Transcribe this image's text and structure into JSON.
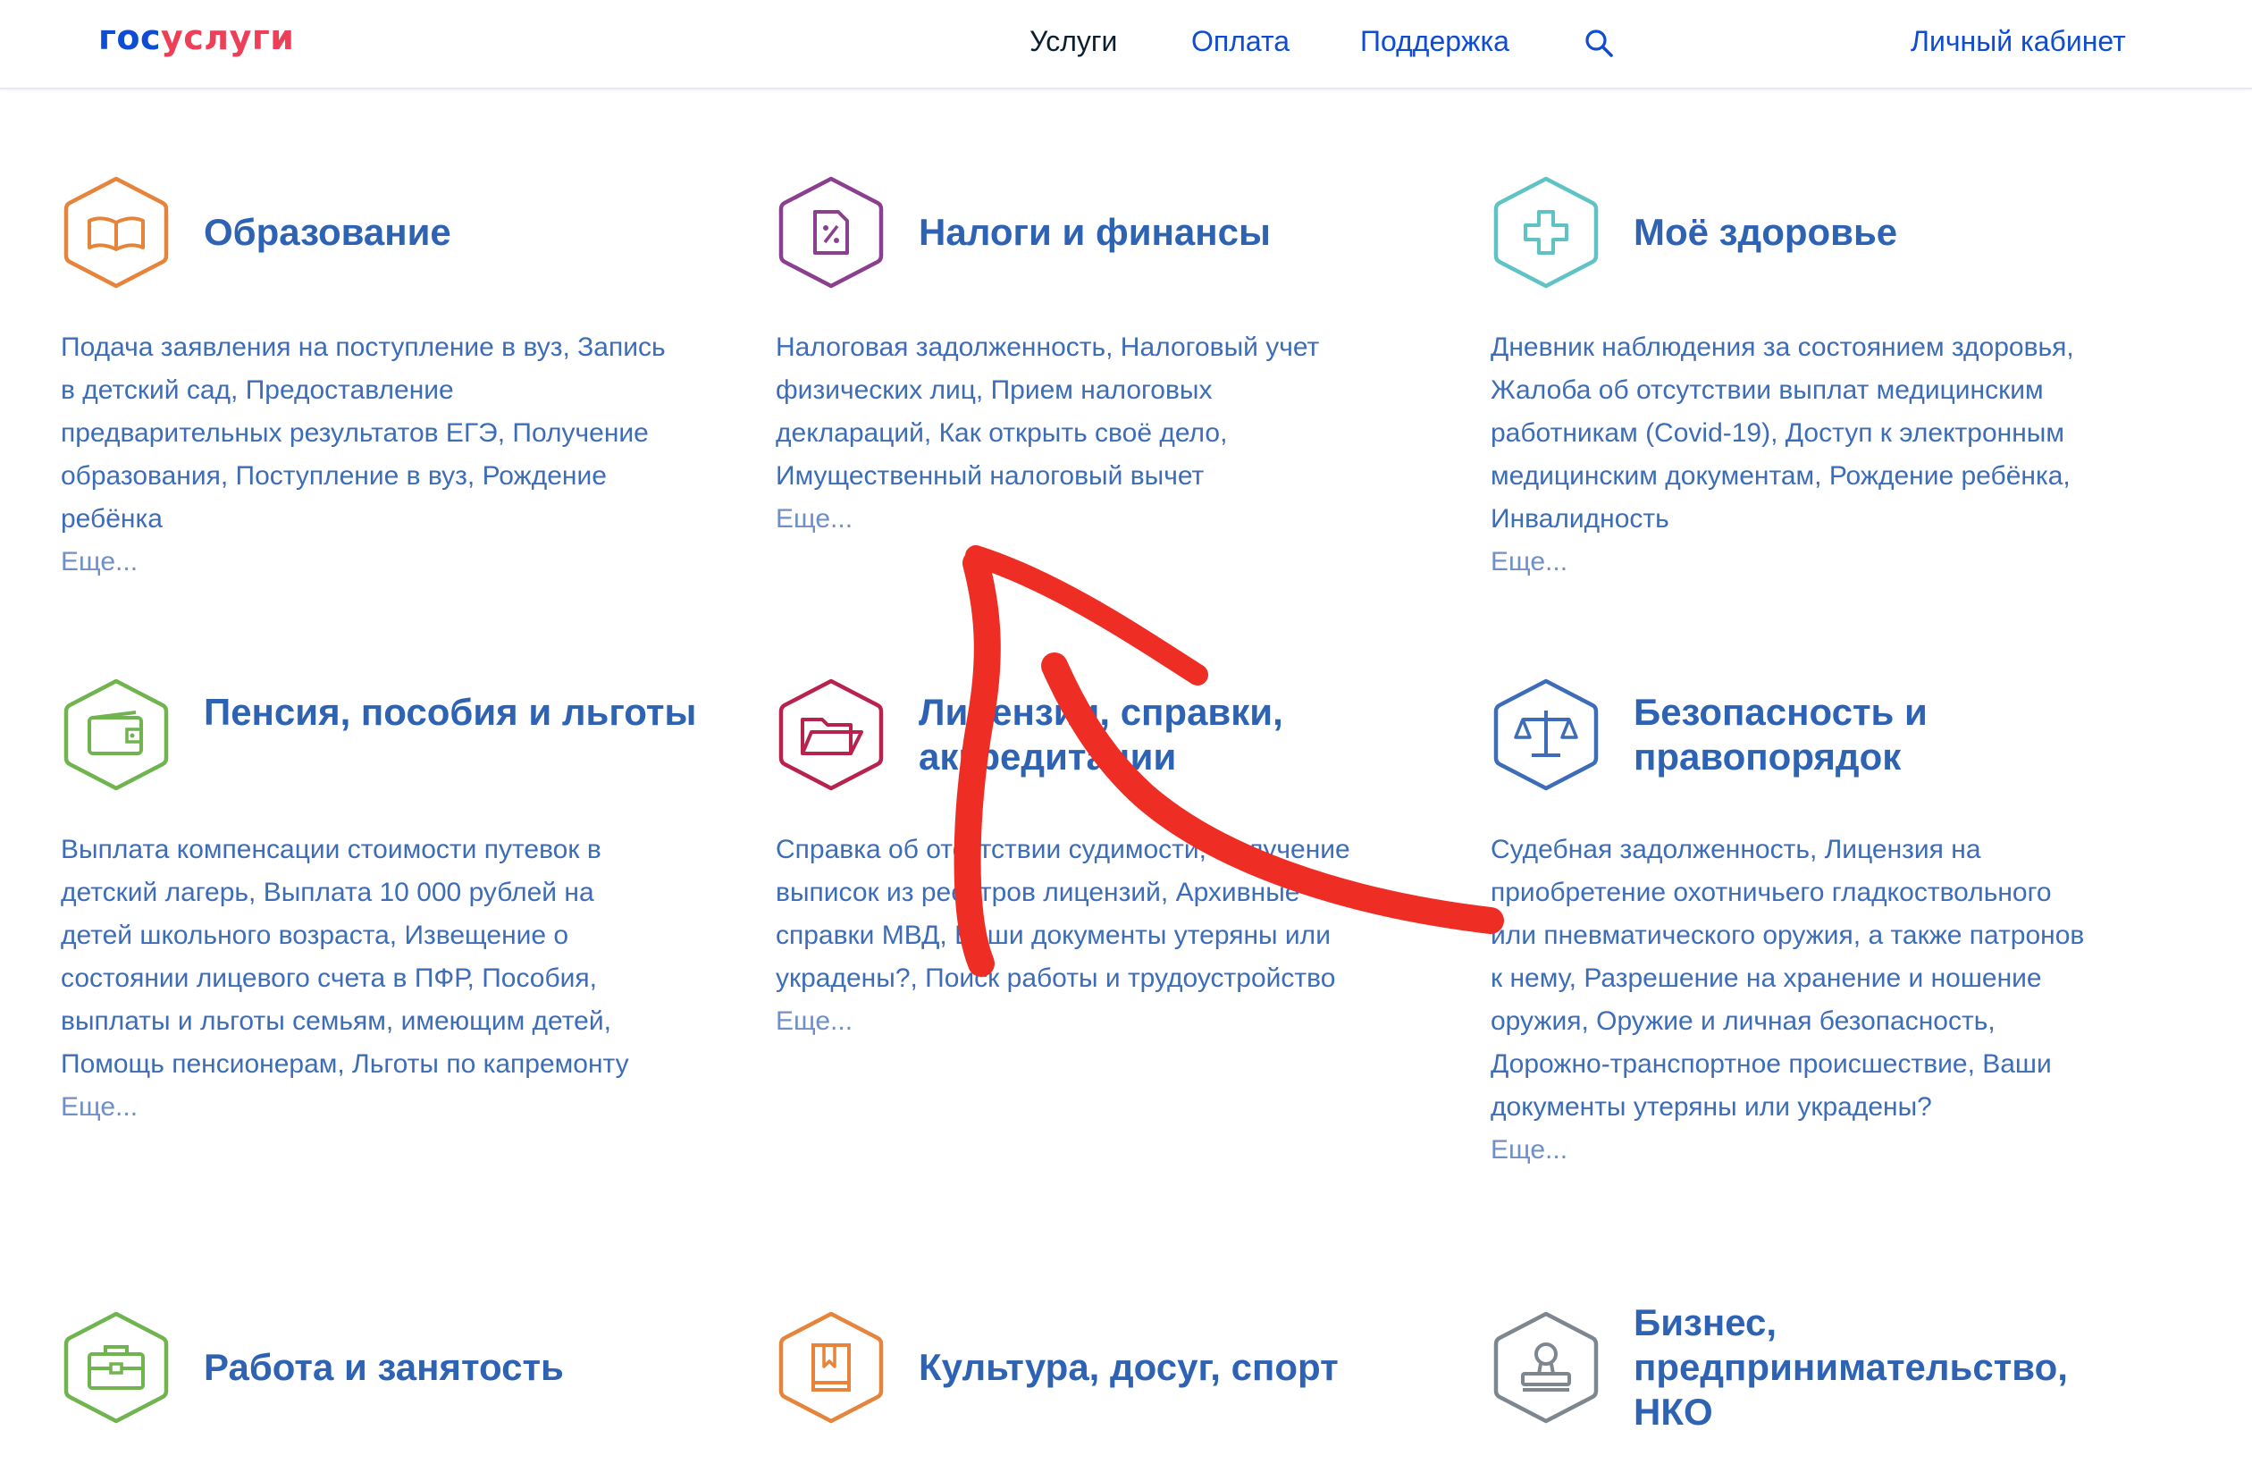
{
  "header": {
    "logo": {
      "part1": "гос",
      "part2": "услуги"
    },
    "nav": {
      "services": "Услуги",
      "payment": "Оплата",
      "support": "Поддержка"
    },
    "search_icon": "search-icon",
    "account": "Личный кабинет"
  },
  "colors": {
    "brand_blue": "#0d4cd3",
    "brand_red": "#ee3f58",
    "link_blue": "#2e62b3",
    "annotation_red": "#ee2d24"
  },
  "categories": [
    {
      "title": "Образование",
      "icon": "book-icon",
      "color": "#e5843a",
      "description": "Подача заявления на поступление в вуз, Запись в детский сад, Предоставление предварительных результатов ЕГЭ, Получение образования, Поступление в вуз, Рождение ребёнка",
      "more": "Еще..."
    },
    {
      "title": "Налоги и финансы",
      "icon": "tax-document-icon",
      "color": "#8b3f8f",
      "description": "Налоговая задолженность, Налоговый учет физических лиц, Прием налоговых деклараций, Как открыть своё дело, Имущественный налоговый вычет",
      "more": "Еще..."
    },
    {
      "title": "Моё здоровье",
      "icon": "medical-cross-icon",
      "color": "#5fc3c6",
      "description": "Дневник наблюдения за состоянием здоровья, Жалоба об отсутствии выплат медицинским работникам (Covid-19), Доступ к электронным медицинским документам, Рождение ребёнка, Инвалидность",
      "more": "Еще..."
    },
    {
      "title": "Пенсия, пособия и льготы",
      "icon": "wallet-icon",
      "color": "#6fb44f",
      "description": "Выплата компенсации стоимости путевок в детский лагерь, Выплата 10 000 рублей на детей школьного возраста, Извещение о состоянии лицевого счета в ПФР, Пособия, выплаты и льготы семьям, имеющим детей, Помощь пенсионерам, Льготы по капремонту",
      "more": "Еще..."
    },
    {
      "title": "Лицензии, справки, аккредитации",
      "icon": "folder-icon",
      "color": "#b8234e",
      "description": "Справка об отсутствии судимости, Получение выписок из реестров лицензий, Архивные справки МВД, Ваши документы утеряны или украдены?, Поиск работы и трудоустройство",
      "more": "Еще..."
    },
    {
      "title": "Безопасность и правопорядок",
      "icon": "scales-icon",
      "color": "#3d6db8",
      "description": "Судебная задолженность, Лицензия на приобретение охотничьего гладкоствольного или пневматического оружия, а также патронов к нему, Разрешение на хранение и ношение оружия, Оружие и личная безопасность, Дорожно-транспортное происшествие, Ваши документы утеряны или украдены?",
      "more": "Еще..."
    },
    {
      "title": "Работа и занятость",
      "icon": "briefcase-icon",
      "color": "#6fb44f"
    },
    {
      "title": "Культура, досуг, спорт",
      "icon": "book-bookmark-icon",
      "color": "#e5843a"
    },
    {
      "title": "Бизнес, предпринимательство, НКО",
      "icon": "stamp-icon",
      "color": "#7e8790"
    }
  ]
}
